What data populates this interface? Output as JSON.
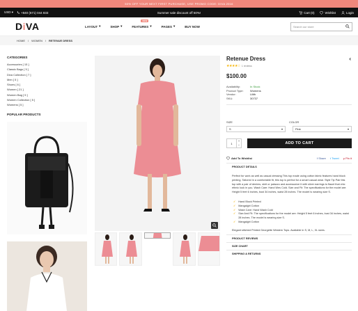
{
  "promo": "50% OFF YOUR NEXT FIRST PURCHASE, USE PROMO CODE: DIVA 2016",
  "topbar": {
    "currency": "USD ▾",
    "phone": "+840 (671) 044 833",
    "promo": "Summer sale discount off 50%!",
    "cart": "Cart (0)",
    "wishlist": "Wishlist",
    "login": "Login"
  },
  "header": {
    "logo_a": "D",
    "logo_i": "i",
    "logo_b": "VA",
    "nav": [
      "LAYOUT",
      "SHOP",
      "FEATURES",
      "PAGES",
      "BUY NOW"
    ],
    "new_badge": "NEW",
    "search_placeholder": "Search our store"
  },
  "breadcrumb": {
    "home": "HOME",
    "sep1": "/",
    "women": "WOMEN",
    "sep2": "/",
    "current": "RETENUE DRESS"
  },
  "sidebar": {
    "categories_title": "CATEGORIES",
    "categories": [
      "Accessories [ 15 ]",
      "Classic Bags [ 5 ]",
      "Diva Collection [ 7 ]",
      "Men [ 5 ]",
      "Shoes [ 6 ]",
      "Women [ 21 ]",
      "Women Bag [ 5 ]",
      "Women Collection [ 5 ]",
      "Womens [ 5 ]"
    ],
    "popular_title": "POPULAR PRODUCTS"
  },
  "product": {
    "title": "Retenue Dress",
    "rating": 4,
    "reviews": "1 reviews",
    "price": "$100.00",
    "meta": [
      {
        "k": "Availability:",
        "v": "In Stock"
      },
      {
        "k": "Product Type:",
        "v": "Womens"
      },
      {
        "k": "Vendor:",
        "v": "Lilith"
      },
      {
        "k": "SKU:",
        "v": "30737"
      }
    ],
    "size_label": "SIZE",
    "color_label": "COLOR",
    "size_value": "S",
    "color_value": "Pink",
    "qty": "1",
    "qty_plus": "+",
    "qty_minus": "−",
    "add_to_cart": "ADD TO CART",
    "wishlist": "Add To Wishlist",
    "share": "Share",
    "tweet": "Tweet",
    "pin": "Pin it",
    "details_title": "PRODUCT DETAILS",
    "description": "Perfect for work as well as casual dressing This top made using cotton fabric features hand block printing. Tailored in a comfortable fit, this top is perfect for a smart casual wear. Style Tip Pair this top with a pair of denims, skirt or palazzo and accessorize it with silver earrings to flaunt that chic ethnic look in you. Wash Care: Hand Wes Cold. Size and Fit: The specifications for the model are: Height 5 feet 6 inches, bust 34 inches, waist 28 inches. The model is wearing size S.",
    "features": [
      "Hand Block Printed",
      "Mangalgiri Cotton",
      "Wash Care: Hand Wash Cold",
      "Size And Fit: The specifications for the model are: Height 5 feet 6 inches, bust 34 inches, waist 28 inches. The model is wearing size S.",
      "Mangalgiri Cotton"
    ],
    "extra_line": "Elegant stitched Printed Georgette Western Tops. Available in S, M, L, XL sizes.",
    "reviews_title": "PRODUCT REVIEWS",
    "size_chart": "SIZE CHART",
    "shipping": "SHIPPING & RETURNS"
  },
  "colors": {
    "accent": "#f0877c",
    "dress": "#ec8d94",
    "dark": "#1a1a1a"
  }
}
